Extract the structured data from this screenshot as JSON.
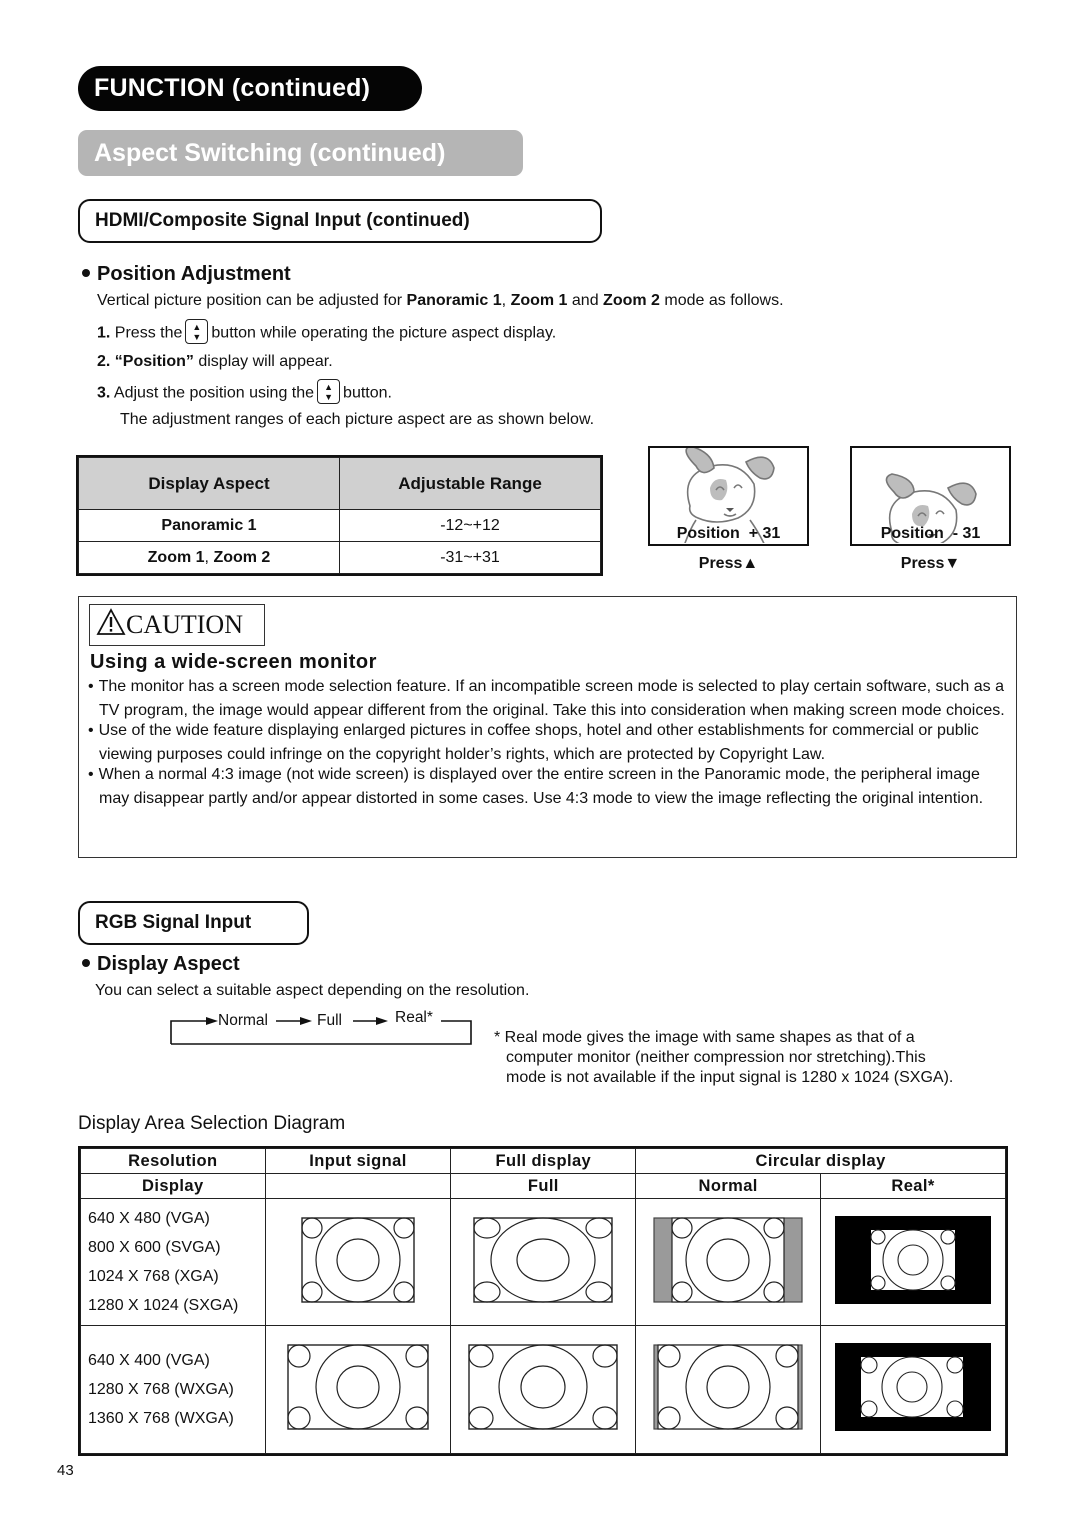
{
  "header": {
    "section_title": "FUNCTION (continued)",
    "subsection_title": "Aspect Switching (continued)"
  },
  "hdmi": {
    "title": "HDMI/Composite Signal Input (continued)",
    "position_adjustment": {
      "heading": "Position Adjustment",
      "intro": {
        "prefix": "Vertical picture position can be adjusted for ",
        "bold1": "Panoramic 1",
        "sep1": ", ",
        "bold2": "Zoom 1",
        "mid": " and ",
        "bold3": "Zoom 2",
        "suffix": " mode as follows."
      },
      "steps": [
        {
          "num": "1.",
          "before": "Press the",
          "after": "button while operating the picture aspect display."
        },
        {
          "num": "2.",
          "bold": "“Position”",
          "after": " display will appear."
        },
        {
          "num": "3.",
          "before": "Adjust the position using the",
          "after": "button."
        }
      ],
      "note": "The adjustment ranges of each picture aspect are as shown below.",
      "table": {
        "headers": [
          "Display Aspect",
          "Adjustable Range"
        ],
        "rows": [
          {
            "aspect": "Panoramic 1",
            "range": "-12~+12"
          },
          {
            "aspect_a": "Zoom 1",
            "aspect_sep": ", ",
            "aspect_b": "Zoom 2",
            "range": "-31~+31"
          }
        ]
      },
      "examples": [
        {
          "position_label": "Position  + 31",
          "press_label": "Press▲"
        },
        {
          "position_label": "Position  - 31",
          "press_label": "Press▼"
        }
      ]
    }
  },
  "caution": {
    "badge": "CAUTION",
    "icon": "warning-triangle-icon",
    "title": "Using a wide-screen monitor",
    "items": [
      "The monitor has a screen mode selection feature. If an incompatible screen mode is selected to play certain software, such as a TV program, the image would appear different from the original. Take this into consideration when making screen mode choices.",
      "Use of the wide feature displaying enlarged pictures in coffee shops, hotel and other establishments for commercial or public viewing purposes could infringe on the copyright holder’s rights, which are protected by Copyright Law.",
      "When a normal 4:3 image (not wide screen) is displayed over the entire screen in the Panoramic mode, the peripheral image may disappear partly and/or appear distorted in some cases. Use 4:3 mode to view the image reflecting the original intention."
    ]
  },
  "rgb": {
    "title": "RGB Signal Input",
    "display_aspect": {
      "heading": "Display Aspect",
      "intro": "You can select a suitable aspect depending on the resolution.",
      "cycle": [
        "Normal",
        "Full",
        "Real*"
      ],
      "footnote_lines": [
        "* Real mode gives the image with same shapes as that of a",
        "computer monitor (neither compression nor stretching).This",
        "mode is not available if the input signal is 1280 x 1024 (SXGA)."
      ]
    },
    "diagram": {
      "title": "Display Area Selection Diagram",
      "header_row1": [
        "Resolution",
        "Input signal",
        "Full display",
        "Circular display"
      ],
      "header_row2": [
        "Display",
        "",
        "Full",
        "Normal",
        "Real*"
      ],
      "groups": [
        {
          "resolutions": [
            "640 X 480 (VGA)",
            "800 X 600 (SVGA)",
            "1024 X 768 (XGA)",
            "1280 X 1024 (SXGA)"
          ]
        },
        {
          "resolutions": [
            "640 X 400 (VGA)",
            "1280 X 768 (WXGA)",
            "1360 X 768 (WXGA)"
          ]
        }
      ]
    }
  },
  "footer": {
    "page_number": "43"
  }
}
